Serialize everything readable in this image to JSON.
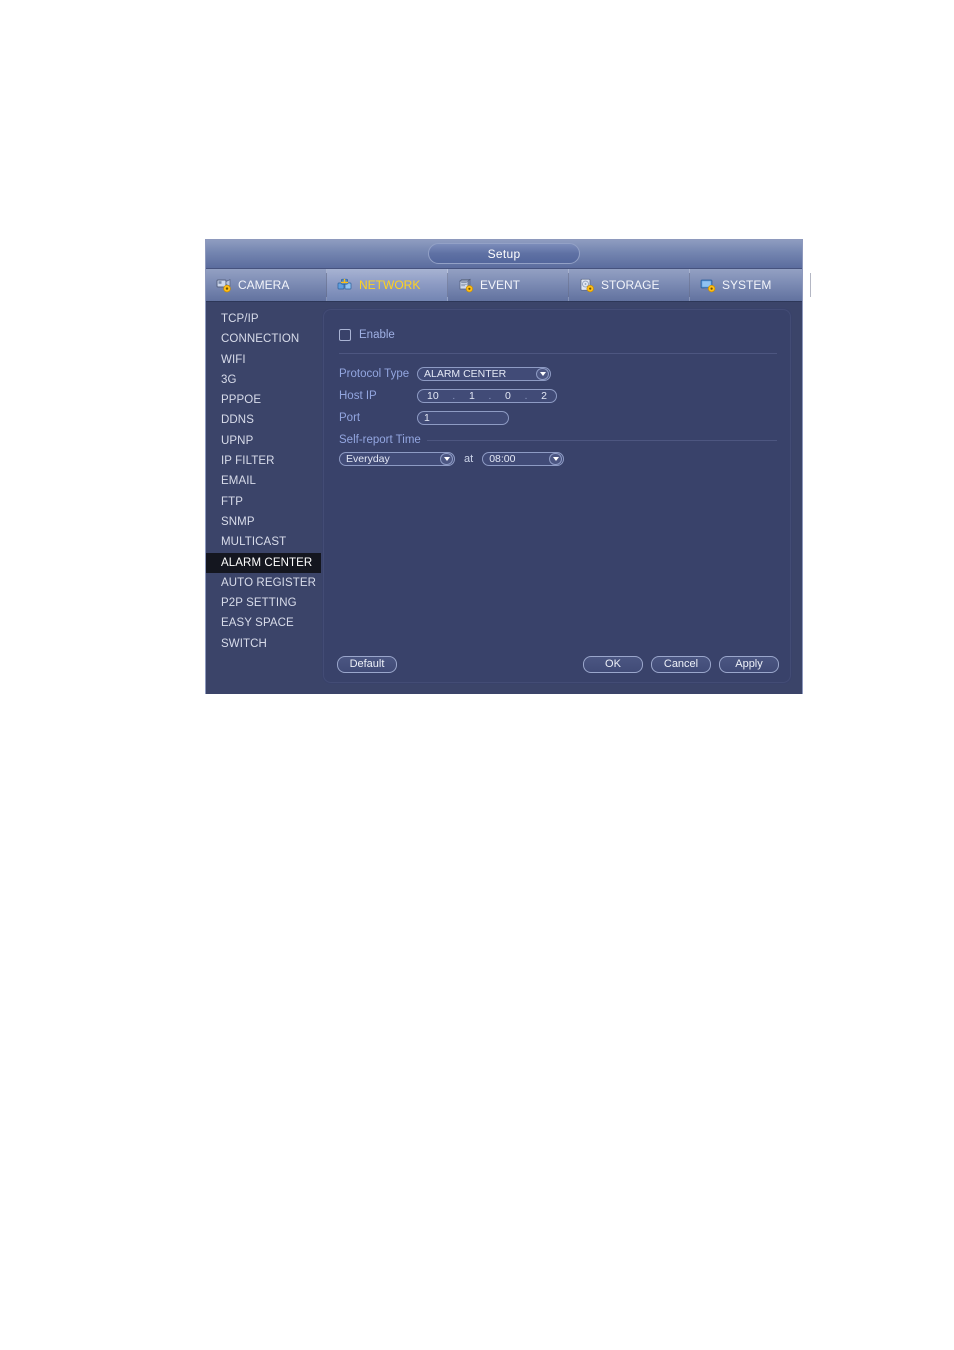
{
  "window": {
    "title": "Setup"
  },
  "tabs": [
    {
      "label": "CAMERA",
      "icon": "camera-gear-icon",
      "active": false
    },
    {
      "label": "NETWORK",
      "icon": "network-gear-icon",
      "active": true
    },
    {
      "label": "EVENT",
      "icon": "event-gear-icon",
      "active": false
    },
    {
      "label": "STORAGE",
      "icon": "storage-gear-icon",
      "active": false
    },
    {
      "label": "SYSTEM",
      "icon": "system-gear-icon",
      "active": false
    }
  ],
  "sidebar": {
    "selected": "ALARM CENTER",
    "items": [
      {
        "label": "TCP/IP"
      },
      {
        "label": "CONNECTION"
      },
      {
        "label": "WIFI"
      },
      {
        "label": "3G"
      },
      {
        "label": "PPPOE"
      },
      {
        "label": "DDNS"
      },
      {
        "label": "UPNP"
      },
      {
        "label": "IP FILTER"
      },
      {
        "label": "EMAIL"
      },
      {
        "label": "FTP"
      },
      {
        "label": "SNMP"
      },
      {
        "label": "MULTICAST"
      },
      {
        "label": "ALARM CENTER"
      },
      {
        "label": "AUTO REGISTER"
      },
      {
        "label": "P2P SETTING"
      },
      {
        "label": "EASY SPACE"
      },
      {
        "label": "SWITCH"
      }
    ]
  },
  "form": {
    "enable": {
      "label": "Enable",
      "checked": false
    },
    "protocol_type": {
      "label": "Protocol Type",
      "value": "ALARM CENTER"
    },
    "host_ip": {
      "label": "Host IP",
      "value": "10 . 1 . 0 . 2",
      "octets": [
        "10",
        "1",
        "0",
        "2"
      ],
      "separator": "."
    },
    "port": {
      "label": "Port",
      "value": "1"
    },
    "self_report": {
      "label": "Self-report Time",
      "day_value": "Everyday",
      "at_label": "at",
      "time_value": "08:00"
    }
  },
  "footer": {
    "default_label": "Default",
    "ok_label": "OK",
    "cancel_label": "Cancel",
    "apply_label": "Apply"
  },
  "colors": {
    "dialog_bg": "#3b4469",
    "panel_bg": "#39426a",
    "tab_active_text": "#ffd21e",
    "label_text": "#93a6e0",
    "selected_item_bg": "#14161f"
  }
}
